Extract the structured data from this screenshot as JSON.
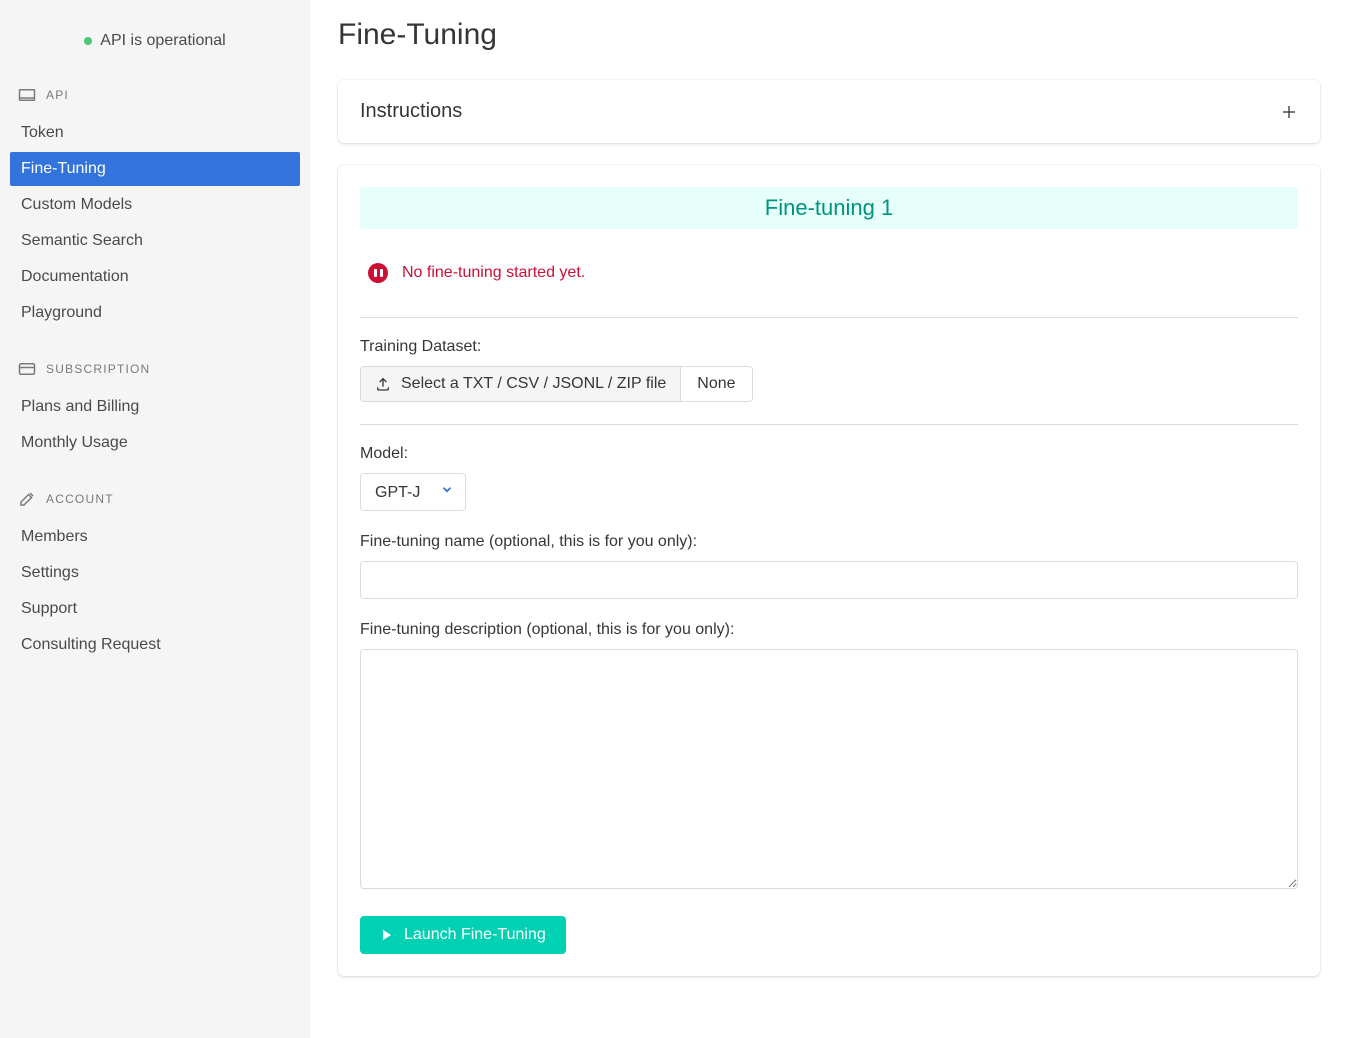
{
  "status_bar": {
    "text": "API is operational"
  },
  "sidebar": {
    "sections": [
      {
        "label": "API",
        "items": [
          {
            "label": "Token"
          },
          {
            "label": "Fine-Tuning"
          },
          {
            "label": "Custom Models"
          },
          {
            "label": "Semantic Search"
          },
          {
            "label": "Documentation"
          },
          {
            "label": "Playground"
          }
        ]
      },
      {
        "label": "SUBSCRIPTION",
        "items": [
          {
            "label": "Plans and Billing"
          },
          {
            "label": "Monthly Usage"
          }
        ]
      },
      {
        "label": "ACCOUNT",
        "items": [
          {
            "label": "Members"
          },
          {
            "label": "Settings"
          },
          {
            "label": "Support"
          },
          {
            "label": "Consulting Request"
          }
        ]
      }
    ]
  },
  "page": {
    "title": "Fine-Tuning"
  },
  "instructions_card": {
    "title": "Instructions"
  },
  "finetune_card": {
    "banner": "Fine-tuning 1",
    "status_text": "No fine-tuning started yet.",
    "training_dataset": {
      "label": "Training Dataset:",
      "button": "Select a TXT / CSV / JSONL / ZIP file",
      "filename": "None"
    },
    "model": {
      "label": "Model:",
      "selected": "GPT-J"
    },
    "name_field": {
      "label": "Fine-tuning name (optional, this is for you only):",
      "value": ""
    },
    "description_field": {
      "label": "Fine-tuning description (optional, this is for you only):",
      "value": ""
    },
    "launch_button": "Launch Fine-Tuning"
  }
}
